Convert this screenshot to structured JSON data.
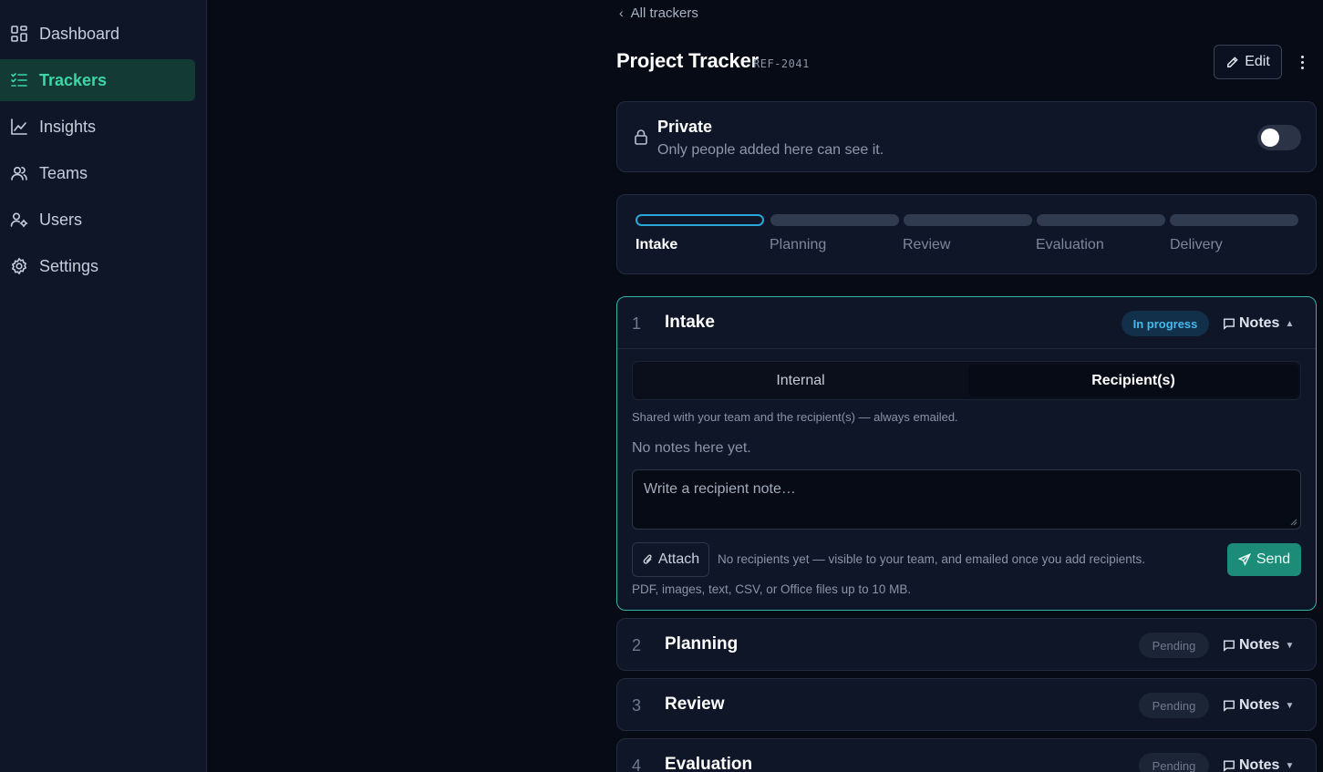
{
  "sidebar": {
    "items": [
      {
        "label": "Dashboard",
        "icon": "dashboard-icon",
        "active": false
      },
      {
        "label": "Trackers",
        "icon": "checklist-icon",
        "active": true
      },
      {
        "label": "Insights",
        "icon": "chart-icon",
        "active": false
      },
      {
        "label": "Teams",
        "icon": "users-icon",
        "active": false
      },
      {
        "label": "Users",
        "icon": "user-gear-icon",
        "active": false
      },
      {
        "label": "Settings",
        "icon": "gear-icon",
        "active": false
      }
    ]
  },
  "header": {
    "back_label": "All trackers",
    "title": "Project Tracker",
    "ref": "REF-2041",
    "edit_label": "Edit"
  },
  "privacy": {
    "title": "Private",
    "subtitle": "Only people added here can see it.",
    "enabled": false
  },
  "steps": {
    "labels": [
      "Intake",
      "Planning",
      "Review",
      "Evaluation",
      "Delivery"
    ],
    "active_index": 0
  },
  "stages": [
    {
      "num": "1",
      "name": "Intake",
      "status": "In progress",
      "notes_label": "Notes",
      "expanded": true,
      "tabs": {
        "internal": "Internal",
        "recipients": "Recipient(s)"
      },
      "help": "Shared with your team and the recipient(s) — always emailed.",
      "empty": "No notes here yet.",
      "placeholder": "Write a recipient note…",
      "attach_label": "Attach",
      "recipients_note": "No recipients yet — visible to your team, and emailed once you add recipients.",
      "send_label": "Send",
      "file_hint": "PDF, images, text, CSV, or Office files up to 10 MB."
    },
    {
      "num": "2",
      "name": "Planning",
      "status": "Pending",
      "notes_label": "Notes",
      "expanded": false
    },
    {
      "num": "3",
      "name": "Review",
      "status": "Pending",
      "notes_label": "Notes",
      "expanded": false
    },
    {
      "num": "4",
      "name": "Evaluation",
      "status": "Pending",
      "notes_label": "Notes",
      "expanded": false
    }
  ],
  "colors": {
    "accent": "#3dd6a6",
    "progress": "#47b8ea",
    "send": "#1c8b78",
    "background": "#070b16",
    "panel": "#0f1628"
  }
}
